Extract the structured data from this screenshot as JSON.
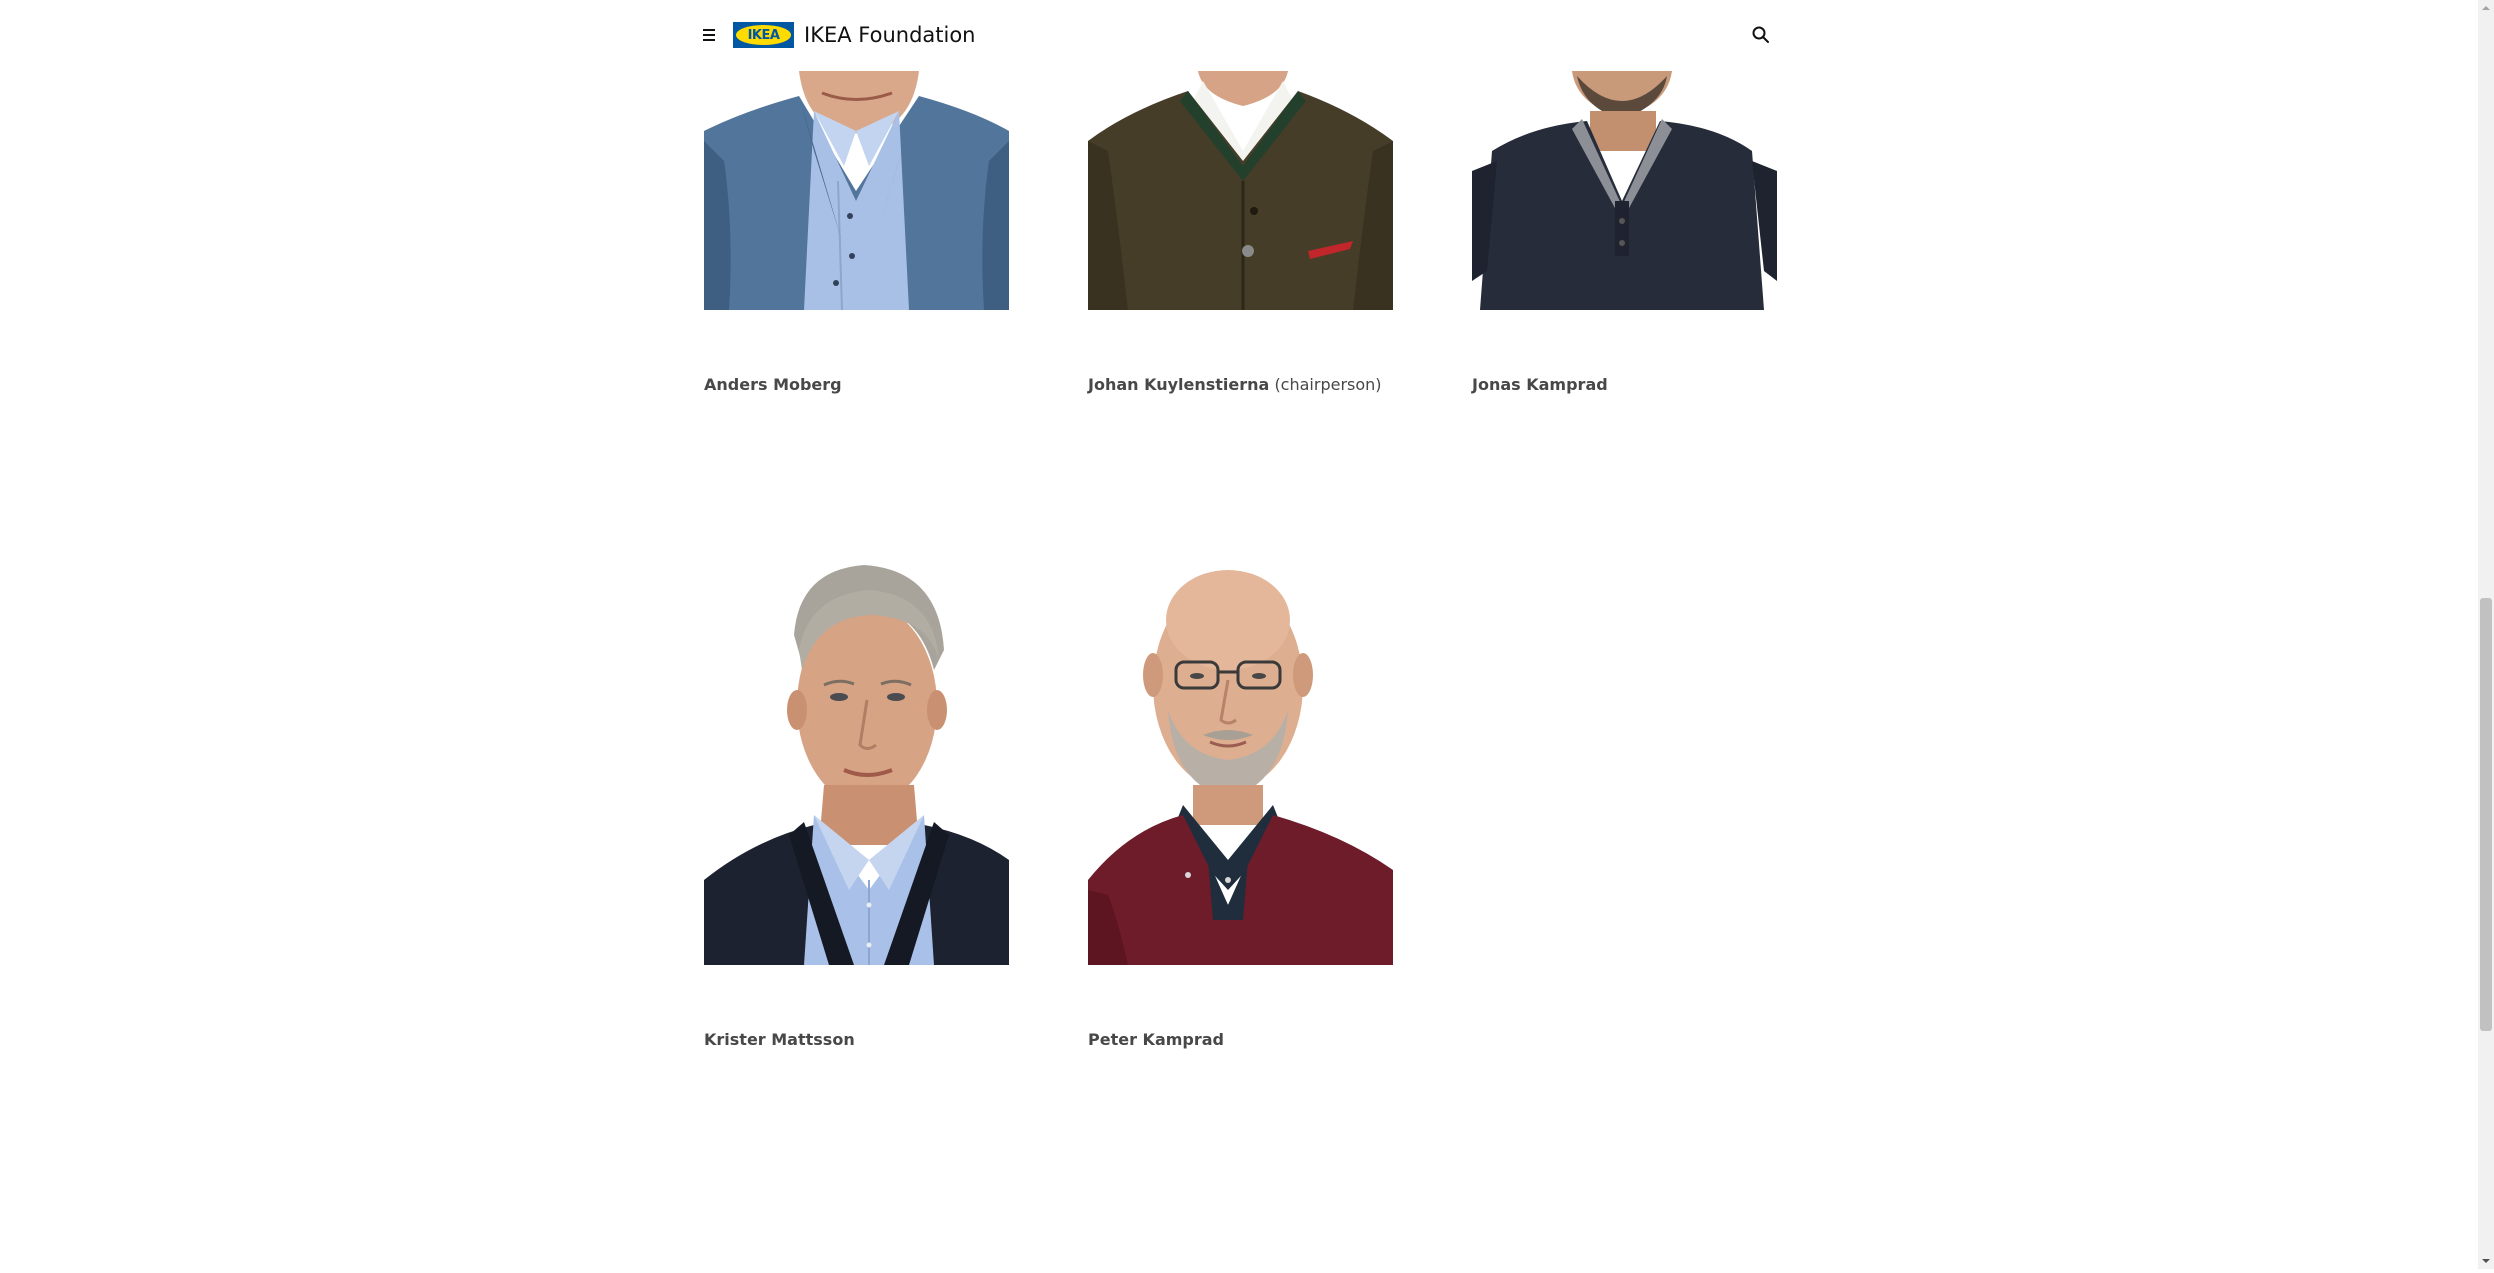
{
  "header": {
    "logo_text": "IKEA",
    "title": "IKEA Foundation",
    "menu_icon": "menu-icon",
    "search_icon": "search-icon",
    "colors": {
      "logo_blue": "#0058a3",
      "logo_yellow": "#ffdb00"
    }
  },
  "board": {
    "members": [
      {
        "name": "Anders Moberg",
        "role": ""
      },
      {
        "name": "Johan Kuylenstierna",
        "role": "(chairperson)"
      },
      {
        "name": "Jonas Kamprad",
        "role": ""
      },
      {
        "name": "Krister Mattsson",
        "role": ""
      },
      {
        "name": "Peter Kamprad",
        "role": ""
      }
    ]
  }
}
